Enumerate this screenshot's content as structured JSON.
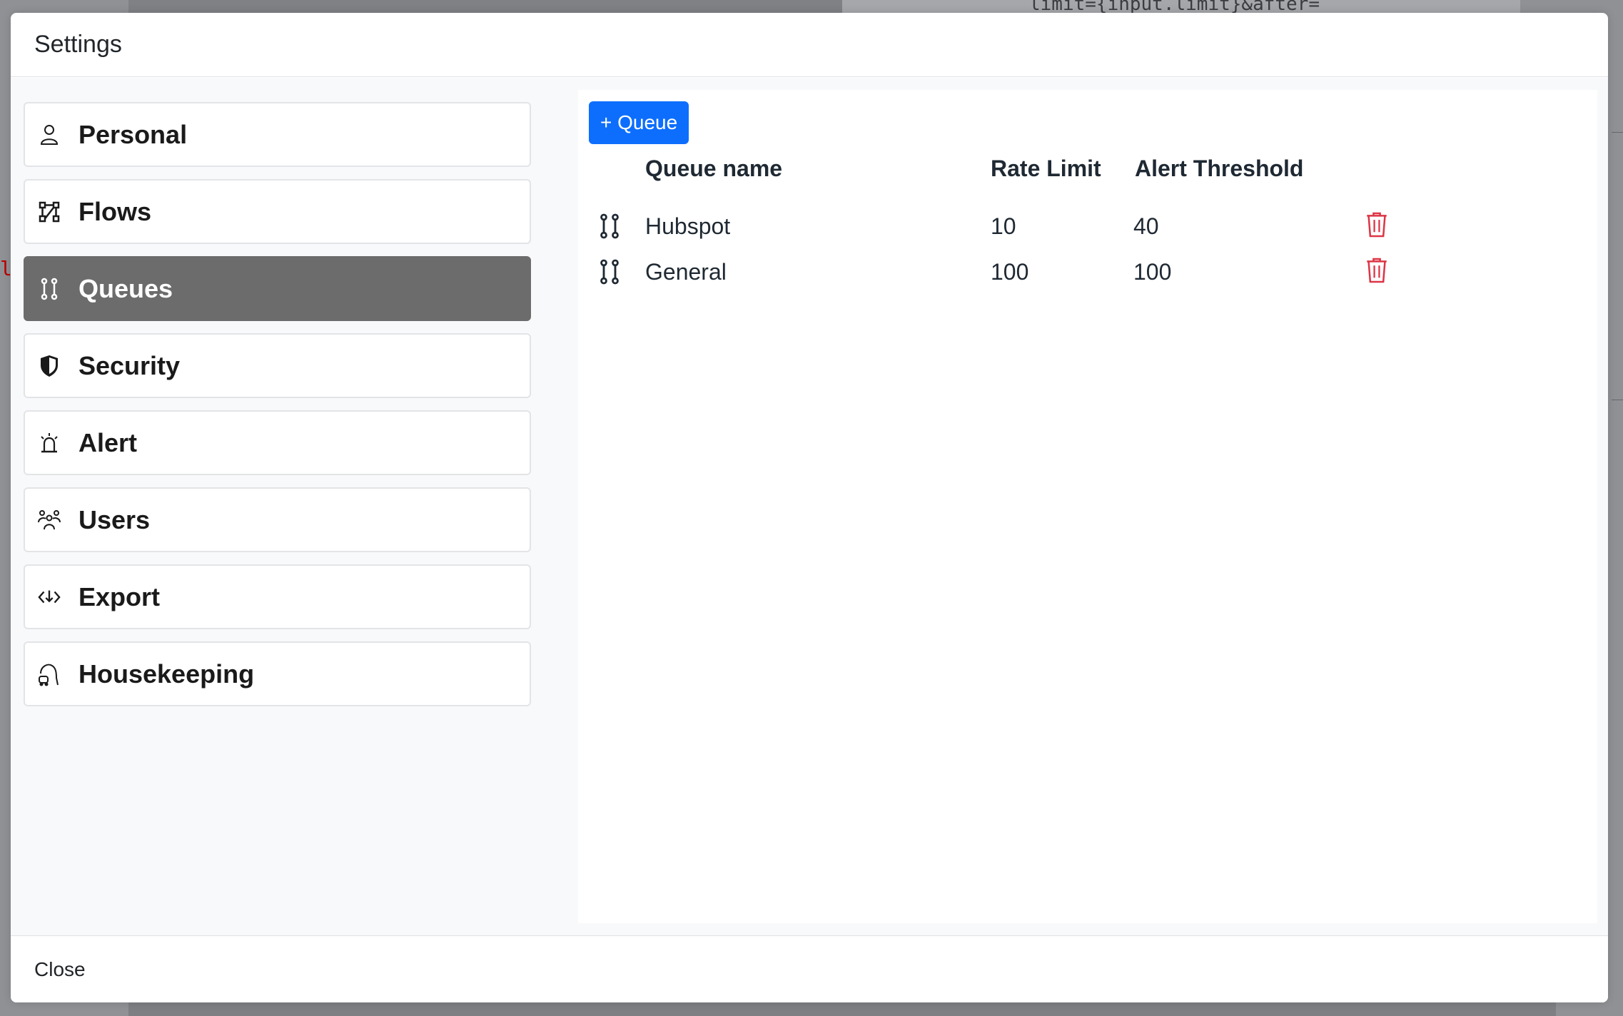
{
  "backdrop": {
    "snippet": "limit={input.limit}&after=",
    "left_glyph": "l"
  },
  "modal": {
    "title": "Settings",
    "close_label": "Close"
  },
  "sidebar": {
    "items": [
      {
        "label": "Personal",
        "icon": "person-icon",
        "active": false
      },
      {
        "label": "Flows",
        "icon": "flows-icon",
        "active": false
      },
      {
        "label": "Queues",
        "icon": "queues-icon",
        "active": true
      },
      {
        "label": "Security",
        "icon": "shield-icon",
        "active": false
      },
      {
        "label": "Alert",
        "icon": "alarm-icon",
        "active": false
      },
      {
        "label": "Users",
        "icon": "users-icon",
        "active": false
      },
      {
        "label": "Export",
        "icon": "export-icon",
        "active": false
      },
      {
        "label": "Housekeeping",
        "icon": "vacuum-icon",
        "active": false
      }
    ]
  },
  "queues": {
    "add_button_label": "+ Queue",
    "columns": [
      "Queue name",
      "Rate Limit",
      "Alert Threshold"
    ],
    "rows": [
      {
        "name": "Hubspot",
        "rate_limit": "10",
        "alert_threshold": "40"
      },
      {
        "name": "General",
        "rate_limit": "100",
        "alert_threshold": "100"
      }
    ]
  },
  "colors": {
    "accent": "#0d6efd",
    "active_nav": "#6c6c6c",
    "danger": "#dc3545"
  }
}
